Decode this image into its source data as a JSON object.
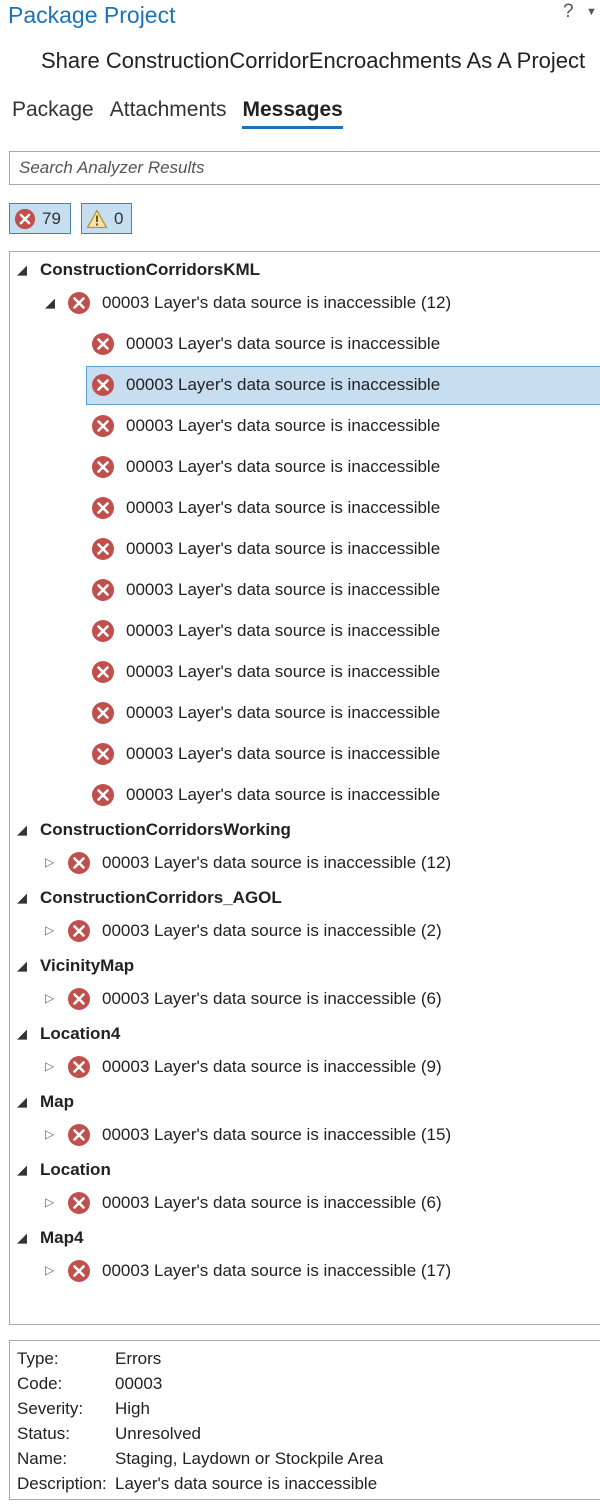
{
  "window": {
    "title": "Package Project",
    "help": "?",
    "subtitle": "Share ConstructionCorridorEncroachments As A Project"
  },
  "tabs": [
    {
      "label": "Package"
    },
    {
      "label": "Attachments"
    },
    {
      "label": "Messages",
      "active": true
    }
  ],
  "search": {
    "placeholder": "Search Analyzer Results"
  },
  "filters": {
    "errors": "79",
    "warnings": "0"
  },
  "tree": {
    "groups": [
      {
        "name": "ConstructionCorridorsKML",
        "parent_message": "00003 Layer's data source is inaccessible (12)",
        "expanded": true,
        "children": [
          "00003 Layer's data source is inaccessible",
          "00003 Layer's data source is inaccessible",
          "00003 Layer's data source is inaccessible",
          "00003 Layer's data source is inaccessible",
          "00003 Layer's data source is inaccessible",
          "00003 Layer's data source is inaccessible",
          "00003 Layer's data source is inaccessible",
          "00003 Layer's data source is inaccessible",
          "00003 Layer's data source is inaccessible",
          "00003 Layer's data source is inaccessible",
          "00003 Layer's data source is inaccessible",
          "00003 Layer's data source is inaccessible"
        ]
      },
      {
        "name": "ConstructionCorridorsWorking",
        "parent_message": "00003 Layer's data source is inaccessible (12)"
      },
      {
        "name": "ConstructionCorridors_AGOL",
        "parent_message": "00003 Layer's data source is inaccessible (2)"
      },
      {
        "name": "VicinityMap",
        "parent_message": "00003 Layer's data source is inaccessible (6)"
      },
      {
        "name": "Location4",
        "parent_message": "00003 Layer's data source is inaccessible (9)"
      },
      {
        "name": "Map",
        "parent_message": "00003 Layer's data source is inaccessible (15)"
      },
      {
        "name": "Location",
        "parent_message": "00003 Layer's data source is inaccessible (6)"
      },
      {
        "name": "Map4",
        "parent_message": "00003 Layer's data source is inaccessible (17)"
      }
    ]
  },
  "details": [
    {
      "key": "Type:",
      "value": "Errors"
    },
    {
      "key": "Code:",
      "value": "00003"
    },
    {
      "key": "Severity:",
      "value": "High"
    },
    {
      "key": "Status:",
      "value": "Unresolved"
    },
    {
      "key": "Name:",
      "value": "Staging, Laydown or Stockpile Area"
    },
    {
      "key": "Description:",
      "value": "Layer's data source is inaccessible"
    }
  ],
  "colors": {
    "accent": "#1d72b8",
    "error": "#c0504d",
    "selection": "#c7ddf0"
  }
}
